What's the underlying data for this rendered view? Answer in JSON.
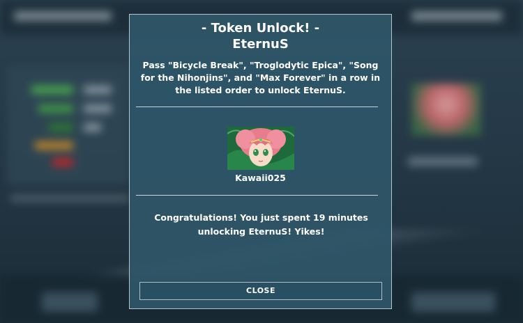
{
  "modal": {
    "title": "- Token Unlock! -",
    "subtitle": "EternuS",
    "description": "Pass \"Bicycle Break\", \"Troglodytic Epica\", \"Song for the Nihonjins\", and \"Max Forever\" in a row in the listed order to unlock EternuS.",
    "avatar_icon": "anime-avatar-image",
    "username": "Kawaii025",
    "congrats": "Congratulations!  You just spent 19 minutes unlocking EternuS! Yikes!",
    "close_label": "CLOSE"
  },
  "colors": {
    "modal_bg": "#2e5668",
    "border": "#b6c6ce",
    "text": "#ffffff"
  }
}
